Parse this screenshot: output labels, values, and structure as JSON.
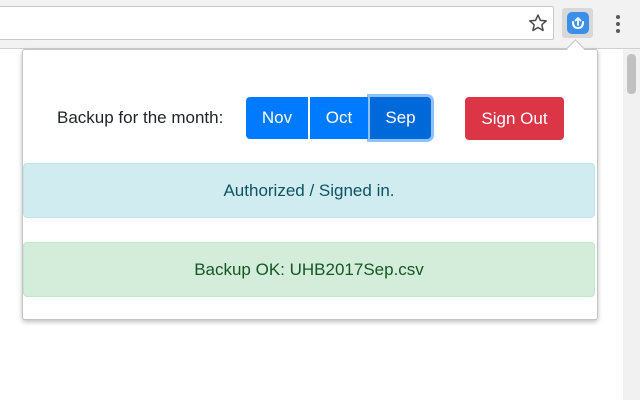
{
  "browser": {
    "bookmark_icon": "star-icon",
    "extension_icon": "backup-extension-icon",
    "menu_icon": "kebab-menu-icon"
  },
  "popup": {
    "backup_label": "Backup for the month:",
    "months": [
      {
        "label": "Nov",
        "active": false
      },
      {
        "label": "Oct",
        "active": false
      },
      {
        "label": "Sep",
        "active": true
      }
    ],
    "sign_out_label": "Sign Out",
    "status_info": "Authorized / Signed in.",
    "status_success": "Backup OK: UHB2017Sep.csv"
  },
  "colors": {
    "primary": "#007bff",
    "danger": "#dc3545",
    "info_bg": "#d1ecf1",
    "success_bg": "#d4edda"
  }
}
